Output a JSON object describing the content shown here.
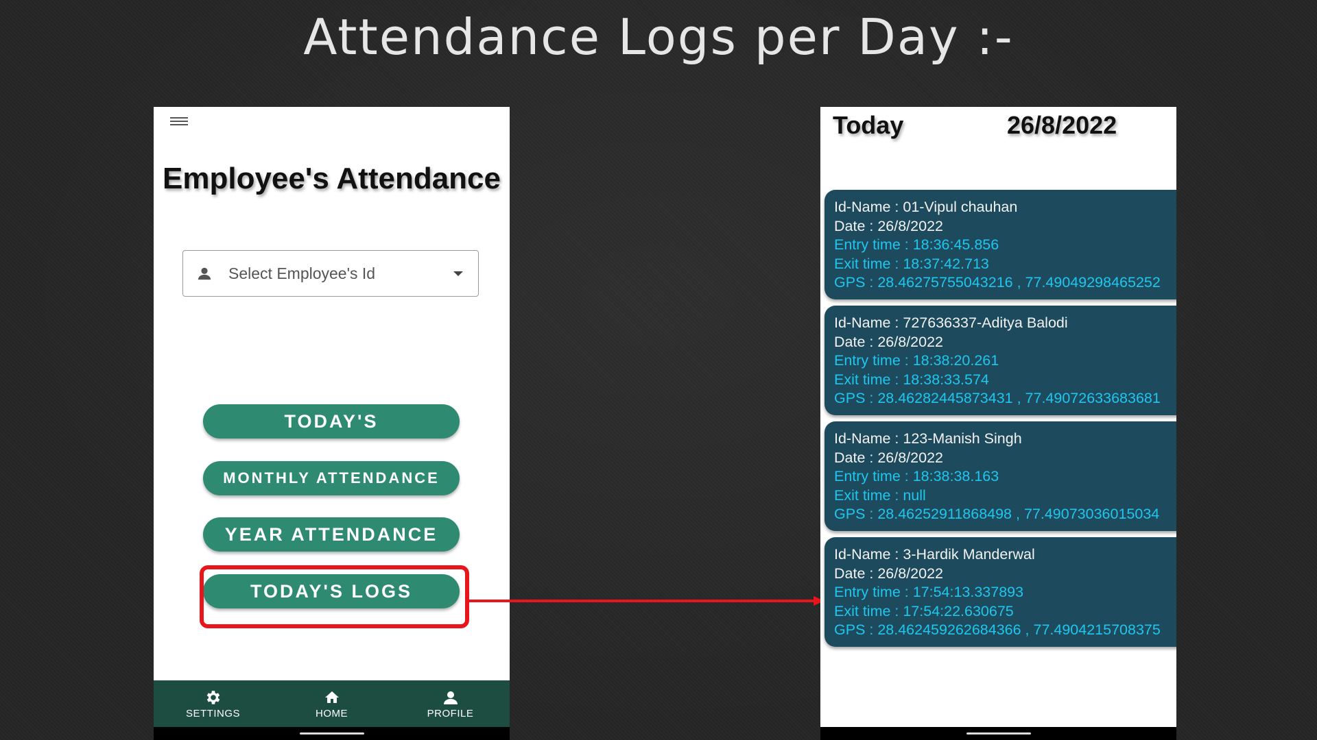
{
  "slide": {
    "title": "Attendance Logs per Day :-"
  },
  "left_phone": {
    "app_title": "Employee's Attendance",
    "select": {
      "placeholder": "Select Employee's Id"
    },
    "buttons": {
      "today": "TODAY'S",
      "monthly": "MONTHLY ATTENDANCE",
      "year": "YEAR ATTENDANCE",
      "logs": "TODAY'S LOGS"
    },
    "bottom_nav": {
      "settings": "SETTINGS",
      "home": "HOME",
      "profile": "PROFILE"
    }
  },
  "right_phone": {
    "header_label": "Today",
    "header_date": "26/8/2022",
    "logs": [
      {
        "id_name": "Id-Name : 01-Vipul chauhan",
        "date": "Date : 26/8/2022",
        "entry": "Entry time : 18:36:45.856",
        "exit": "Exit time : 18:37:42.713",
        "gps": "GPS : 28.46275755043216 , 77.49049298465252"
      },
      {
        "id_name": "Id-Name : 727636337-Aditya Balodi",
        "date": "Date : 26/8/2022",
        "entry": "Entry time : 18:38:20.261",
        "exit": "Exit time : 18:38:33.574",
        "gps": "GPS : 28.46282445873431 , 77.49072633683681"
      },
      {
        "id_name": "Id-Name : 123-Manish Singh",
        "date": "Date : 26/8/2022",
        "entry": "Entry time : 18:38:38.163",
        "exit": "Exit time : null",
        "gps": "GPS : 28.46252911868498 , 77.49073036015034"
      },
      {
        "id_name": "Id-Name : 3-Hardik Manderwal",
        "date": "Date : 26/8/2022",
        "entry": "Entry time : 17:54:13.337893",
        "exit": "Exit time : 17:54:22.630675",
        "gps": "GPS : 28.462459262684366 , 77.4904215708375"
      }
    ]
  },
  "colors": {
    "button_green": "#2e8b72",
    "nav_dark_green": "#1d4d40",
    "card_blue": "#1e4a5e",
    "cyan_text": "#1fc6ee",
    "highlight_red": "#e8151b"
  }
}
